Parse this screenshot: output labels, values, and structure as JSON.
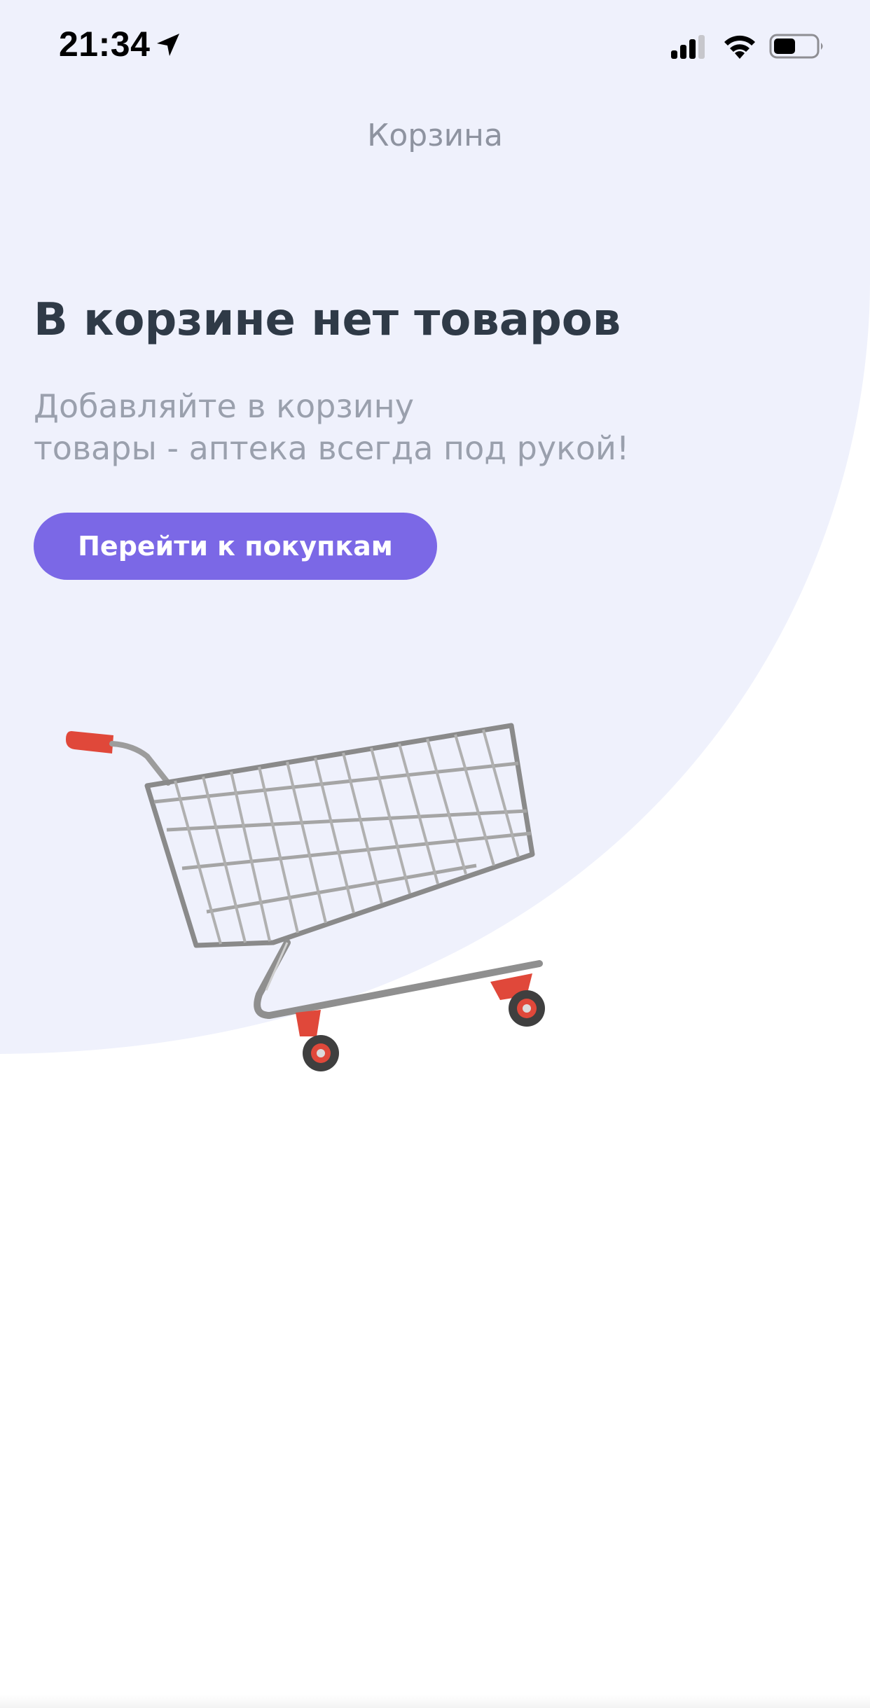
{
  "status_bar": {
    "time": "21:34",
    "icons": [
      "location-arrow-icon",
      "signal-icon",
      "wifi-icon",
      "battery-icon"
    ],
    "battery_level": 0.5
  },
  "header": {
    "title": "Корзина"
  },
  "empty_state": {
    "heading": "В корзине нет товаров",
    "description_lines": [
      "Добавляйте в корзину",
      "товары - аптека всегда под рукой!"
    ],
    "button_label": "Перейти к покупкам",
    "illustration": "shopping-cart-icon"
  },
  "colors": {
    "background_blob": "#eff1fc",
    "accent": "#7b68e6",
    "heading": "#2f3a47",
    "muted_text": "#9aa0ad",
    "cart_accent": "#e0483a"
  }
}
